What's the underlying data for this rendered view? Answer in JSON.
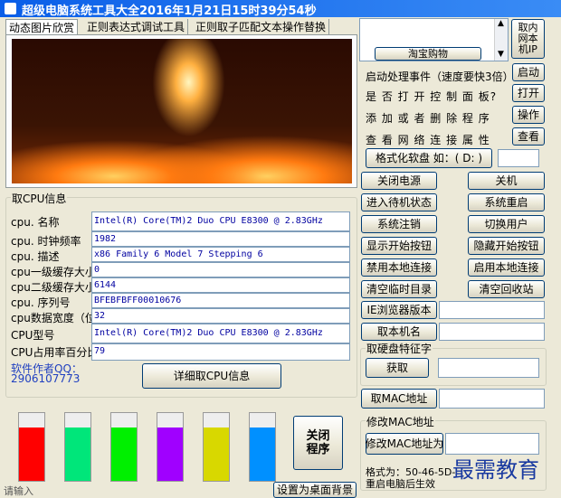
{
  "window": {
    "title": "超级电脑系统工具大全2016年1月21日15时39分54秒",
    "title_colors": {
      "start": "#0a5ee8",
      "end": "#3a8cf5"
    }
  },
  "tabs": [
    {
      "label": "动态图片欣赏",
      "active": true
    },
    {
      "label": "正则表达式调试工具",
      "active": false
    },
    {
      "label": "正则取子匹配文本操作替换",
      "active": false
    }
  ],
  "taobao": {
    "label": "淘宝购物"
  },
  "get_intranet_ip": {
    "label": "取内网本机IP"
  },
  "actions": [
    {
      "text": "启动处理事件（速度要快3倍）",
      "button": "启动"
    },
    {
      "text": "是 否 打 开 控 制 面 板?",
      "button": "打开"
    },
    {
      "text": "添 加 或 者 删 除 程 序",
      "button": "操作"
    },
    {
      "text": "查 看 网 络 连 接 属 性",
      "button": "查看"
    }
  ],
  "format": {
    "label": "格式化软盘 如：( D: )",
    "value": ""
  },
  "grid_buttons": [
    [
      "关闭电源",
      "关机"
    ],
    [
      "进入待机状态",
      "系统重启"
    ],
    [
      "系统注销",
      "切换用户"
    ],
    [
      "显示开始按钮",
      "隐藏开始按钮"
    ],
    [
      "禁用本地连接",
      "启用本地连接"
    ],
    [
      "清空临时目录",
      "清空回收站"
    ]
  ],
  "ie_version": {
    "label": "IE浏览器版本",
    "value": ""
  },
  "machine_name": {
    "label": "取本机名",
    "value": ""
  },
  "disk": {
    "group_title": "取硬盘特征字",
    "button": "获取",
    "value": ""
  },
  "mac": {
    "button": "取MAC地址",
    "value": ""
  },
  "modify_mac": {
    "group_title": "修改MAC地址",
    "button": "修改MAC地址为",
    "value": "",
    "format_line": "格式为：50-46-5D-",
    "note": "重启电脑后生效"
  },
  "cpu": {
    "group_title": "取CPU信息",
    "rows": [
      {
        "label": "cpu. 名称",
        "value": "Intel(R) Core(TM)2 Duo CPU     E8300  @ 2.83GHz"
      },
      {
        "label": "cpu. 时钟频率",
        "value": "1982"
      },
      {
        "label": "cpu. 描述",
        "value": "x86 Family 6 Model 7 Stepping 6"
      },
      {
        "label": "cpu一级缓存大小",
        "value": "0"
      },
      {
        "label": "cpu二级缓存大小",
        "value": "6144"
      },
      {
        "label": "cpu. 序列号",
        "value": "BFEBFBFF00010676"
      },
      {
        "label": "cpu数据宽度（位）",
        "value": "32"
      },
      {
        "label": "CPU型号",
        "value": "Intel(R) Core(TM)2 Duo CPU     E8300  @ 2.83GHz"
      },
      {
        "label": "CPU占用率百分比",
        "value": "79"
      }
    ],
    "author_label": "软件作者QQ：",
    "author_qq": "2906107773",
    "detail_button": "详细取CPU信息"
  },
  "color_swatches": [
    {
      "name": "red",
      "color": "#ff0000"
    },
    {
      "name": "spring-green",
      "color": "#00e67a"
    },
    {
      "name": "green",
      "color": "#00f000"
    },
    {
      "name": "purple",
      "color": "#a000ff"
    },
    {
      "name": "yellow",
      "color": "#d8d800"
    },
    {
      "name": "blue",
      "color": "#0090ff"
    }
  ],
  "close_button": {
    "label": "关闭程序"
  },
  "bottom": {
    "input_text": "请输入",
    "desktop_bg_button": "设置为桌面背景"
  },
  "watermark": {
    "text": "最需教育"
  }
}
